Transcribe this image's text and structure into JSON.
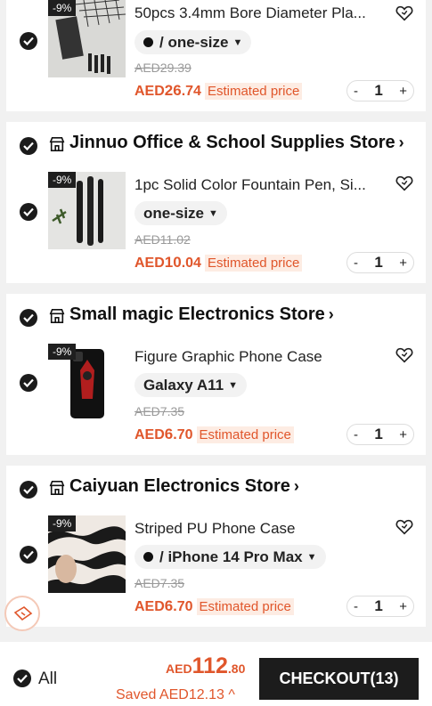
{
  "stores": [
    {
      "name": "",
      "item": {
        "badge": "-9%",
        "title": "50pcs 3.4mm Bore Diameter Pla...",
        "variant": "/ one-size",
        "variant_dot": true,
        "original_price": "AED29.39",
        "price_currency": "AED",
        "price_int": "26",
        "price_dec": ".74",
        "estimated_label": "Estimated price",
        "qty_minus": "-",
        "quantity": "1",
        "qty_plus": "+"
      }
    },
    {
      "name": "Jinnuo Office & School Supplies Store",
      "item": {
        "badge": "-9%",
        "title": "1pc Solid Color Fountain Pen, Si...",
        "variant": "one-size",
        "variant_dot": false,
        "original_price": "AED11.02",
        "price_currency": "AED",
        "price_int": "10",
        "price_dec": ".04",
        "estimated_label": "Estimated price",
        "qty_minus": "-",
        "quantity": "1",
        "qty_plus": "+"
      }
    },
    {
      "name": "Small magic Electronics Store",
      "item": {
        "badge": "-9%",
        "title": "Figure Graphic Phone Case",
        "variant": "Galaxy A11",
        "variant_dot": false,
        "original_price": "AED7.35",
        "price_currency": "AED",
        "price_int": "6",
        "price_dec": ".70",
        "estimated_label": "Estimated price",
        "qty_minus": "-",
        "quantity": "1",
        "qty_plus": "+"
      }
    },
    {
      "name": "Caiyuan Electronics Store",
      "item": {
        "badge": "-9%",
        "title": "Striped PU Phone Case",
        "variant": "/ iPhone 14 Pro Max",
        "variant_dot": true,
        "original_price": "AED7.35",
        "price_currency": "AED",
        "price_int": "6",
        "price_dec": ".70",
        "estimated_label": "Estimated price",
        "qty_minus": "-",
        "quantity": "1",
        "qty_plus": "+"
      }
    }
  ],
  "footer": {
    "all_label": "All",
    "total_currency": "AED",
    "total_int": "112",
    "total_dec": ".80",
    "saved_text": "Saved AED12.13",
    "checkout_label": "CHECKOUT(13)"
  },
  "colors": {
    "accent": "#e0562b",
    "checkout_bg": "#1c1c1c"
  }
}
